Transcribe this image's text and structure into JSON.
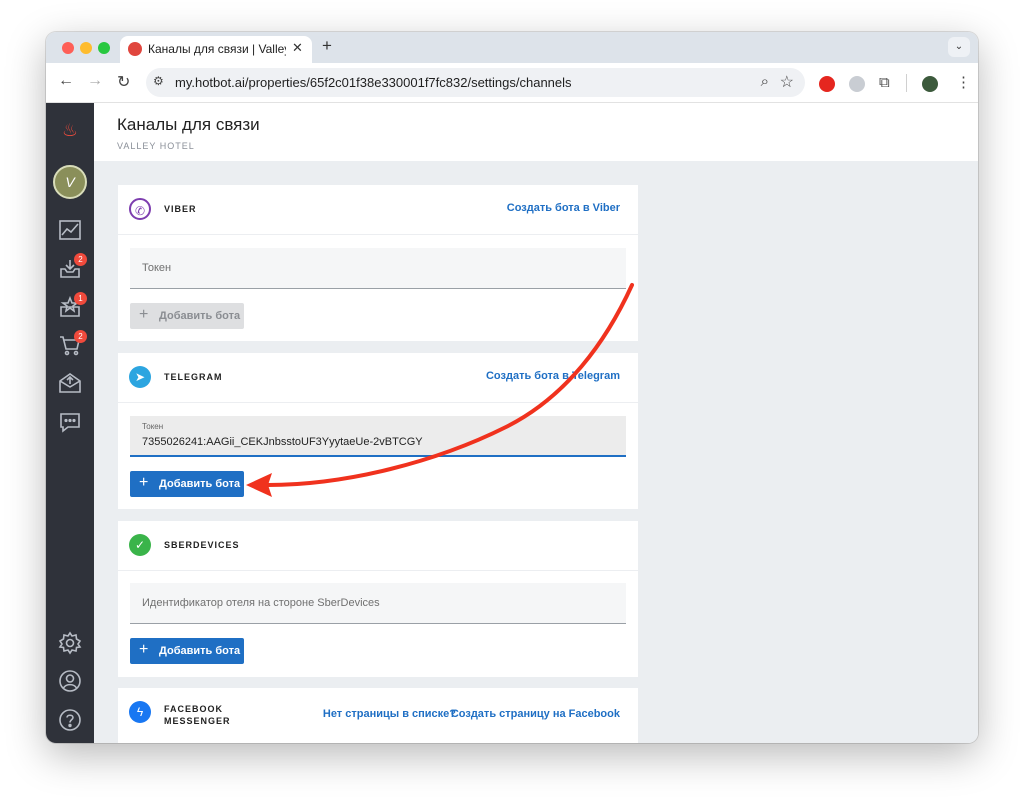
{
  "browser": {
    "tab_title": "Каналы для связи | Valley Ho",
    "tab_close": "✕",
    "new_tab": "+",
    "tab_menu": "⌄",
    "url": "my.hotbot.ai/properties/65f2c01f38e330001f7fc832/settings/channels",
    "back": "←",
    "forward": "→",
    "reload": "↻"
  },
  "sidebar": {
    "avatar_letter": "V",
    "badges": {
      "inbox": "2",
      "reviews": "1",
      "orders": "2"
    }
  },
  "header": {
    "title": "Каналы для связи",
    "subtitle": "VALLEY HOTEL"
  },
  "channels": {
    "viber": {
      "name": "VIBER",
      "link": "Создать бота в Viber",
      "field_placeholder": "Токен",
      "button": "Добавить бота"
    },
    "telegram": {
      "name": "TELEGRAM",
      "link": "Создать бота в Telegram",
      "field_label": "Токен",
      "field_value": "7355026241:AAGii_CEKJnbsstoUF3YyytaeUe-2vBTCGY",
      "button": "Добавить бота"
    },
    "sberdevices": {
      "name": "SBERDEVICES",
      "field_placeholder": "Идентификатор отеля на стороне SberDevices",
      "button": "Добавить бота"
    },
    "facebook": {
      "name_line1": "FACEBOOK",
      "name_line2": "MESSENGER",
      "link_no_page": "Нет страницы в списке?",
      "link_create": "Создать страницу на Facebook"
    }
  },
  "colors": {
    "accent": "#1f6fc4",
    "sidebar": "#2f323a",
    "annotation_arrow": "#f0321e",
    "badge": "#f04a3c"
  }
}
